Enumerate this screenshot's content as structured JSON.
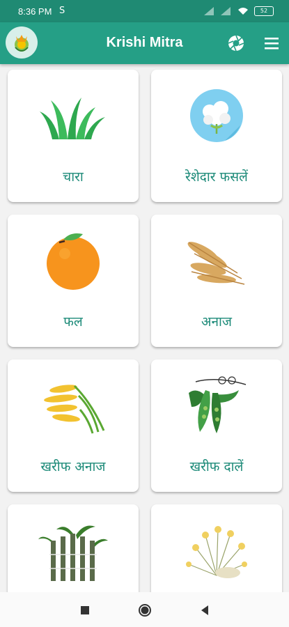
{
  "status_bar": {
    "time": "8:36 PM",
    "indicator": "S",
    "battery": "52"
  },
  "app_bar": {
    "title": "Krishi Mitra",
    "background_color": "#259f86"
  },
  "categories": [
    {
      "label": "चारा",
      "icon": "grass-icon"
    },
    {
      "label": "रेशेदार फसलें",
      "icon": "cotton-icon"
    },
    {
      "label": "फल",
      "icon": "orange-icon"
    },
    {
      "label": "अनाज",
      "icon": "wheat-icon"
    },
    {
      "label": "खरीफ अनाज",
      "icon": "rice-icon"
    },
    {
      "label": "खरीफ दालें",
      "icon": "pea-pod-icon"
    },
    {
      "label": "",
      "icon": "sugarcane-icon"
    },
    {
      "label": "",
      "icon": "spice-flower-icon"
    }
  ],
  "nav_bar": {
    "buttons": [
      "recents-icon",
      "home-icon",
      "back-icon"
    ]
  }
}
